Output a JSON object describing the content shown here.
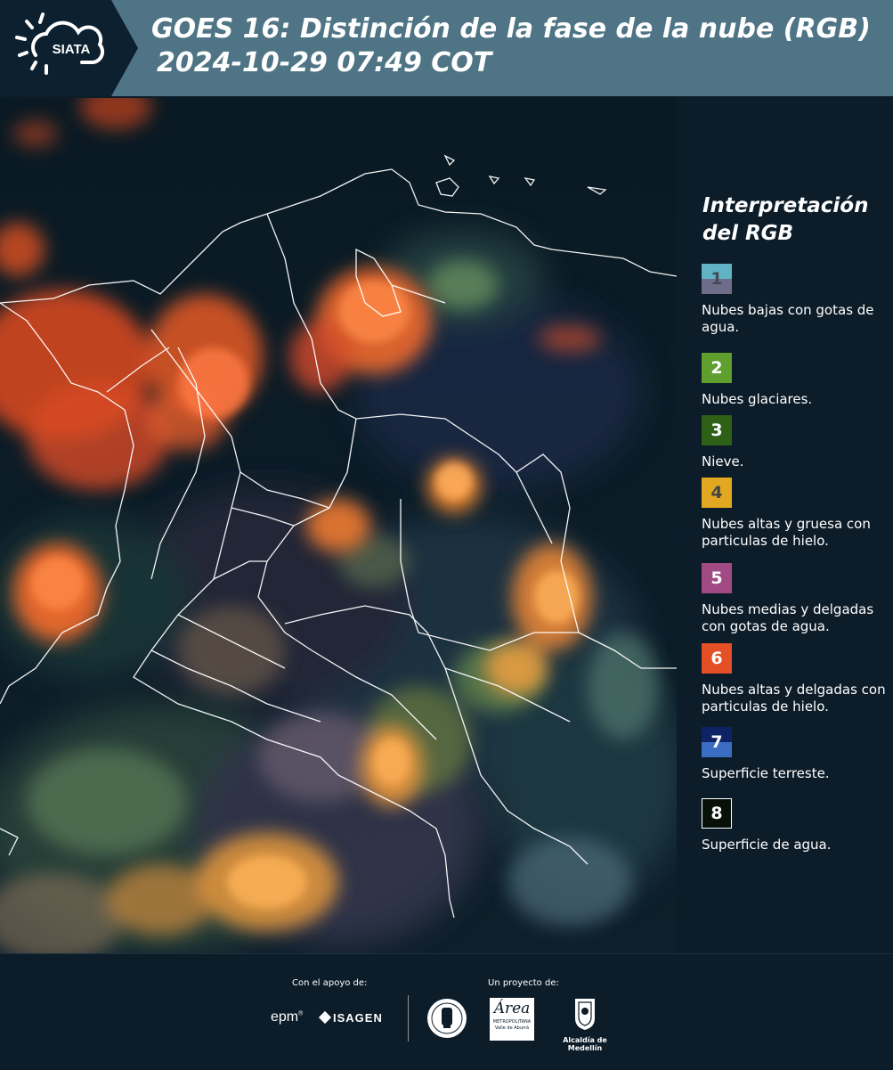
{
  "header": {
    "logo_text": "SIATA",
    "title_line1": "GOES 16: Distinción de la fase de la nube (RGB)",
    "title_line2": "2024-10-29 07:49 COT"
  },
  "legend": {
    "title": "Interpretación del RGB",
    "items": [
      {
        "number": "1",
        "label": "Nubes bajas con gotas de agua.",
        "color_top": "#5fb3c4",
        "color_bottom": "#6f6c8a",
        "number_color": "#444a58"
      },
      {
        "number": "2",
        "label": "Nubes glaciares.",
        "color_top": "#5e9f2e",
        "color_bottom": "#5e9f2e",
        "number_color": "#ffffff"
      },
      {
        "number": "3",
        "label": "Nieve.",
        "color_top": "#2e6016",
        "color_bottom": "#2e6016",
        "number_color": "#ffffff"
      },
      {
        "number": "4",
        "label": "Nubes altas y gruesa con particulas de hielo.",
        "color_top": "#e3a821",
        "color_bottom": "#e3a821",
        "number_color": "#444444"
      },
      {
        "number": "5",
        "label": "Nubes medias y delgadas con gotas de agua.",
        "color_top": "#a14a83",
        "color_bottom": "#a14a83",
        "number_color": "#ffffff"
      },
      {
        "number": "6",
        "label": "Nubes altas y delgadas con particulas de hielo.",
        "color_top": "#e54f25",
        "color_bottom": "#e54f25",
        "number_color": "#ffffff"
      },
      {
        "number": "7",
        "label": "Superficie terreste.",
        "color_top": "#0e2366",
        "color_bottom": "#3b6ec2",
        "number_color": "#ffffff"
      },
      {
        "number": "8",
        "label": "Superficie de agua.",
        "color_top": "#071108",
        "color_bottom": "#071108",
        "number_color": "#ffffff"
      }
    ]
  },
  "footer": {
    "support_label": "Con el apoyo de:",
    "project_label": "Un proyecto de:",
    "epm": "epm",
    "isagen": "ISAGEN",
    "area_name": "Área",
    "area_sub1": "METROPOLITANA",
    "area_sub2": "Valle de Aburrá",
    "alcaldia": "Alcaldía de Medellín"
  }
}
